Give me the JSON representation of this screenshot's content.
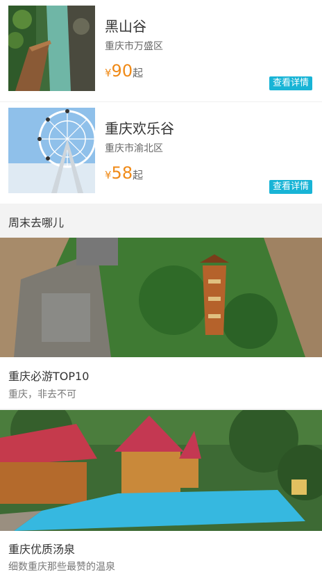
{
  "spots": [
    {
      "name": "黑山谷",
      "location": "重庆市万盛区",
      "currency": "¥",
      "price": "90",
      "suffix": "起",
      "button": "查看详情"
    },
    {
      "name": "重庆欢乐谷",
      "location": "重庆市渝北区",
      "currency": "¥",
      "price": "58",
      "suffix": "起",
      "button": "查看详情"
    }
  ],
  "section": {
    "title": "周末去哪儿"
  },
  "cards": [
    {
      "title": "重庆必游TOP10",
      "subtitle": "重庆，非去不可"
    },
    {
      "title": "重庆优质汤泉",
      "subtitle": "细数重庆那些最赞的温泉"
    }
  ],
  "colors": {
    "accent": "#18b4d6",
    "price": "#f08a17",
    "section_bg": "#f3f3f3"
  }
}
